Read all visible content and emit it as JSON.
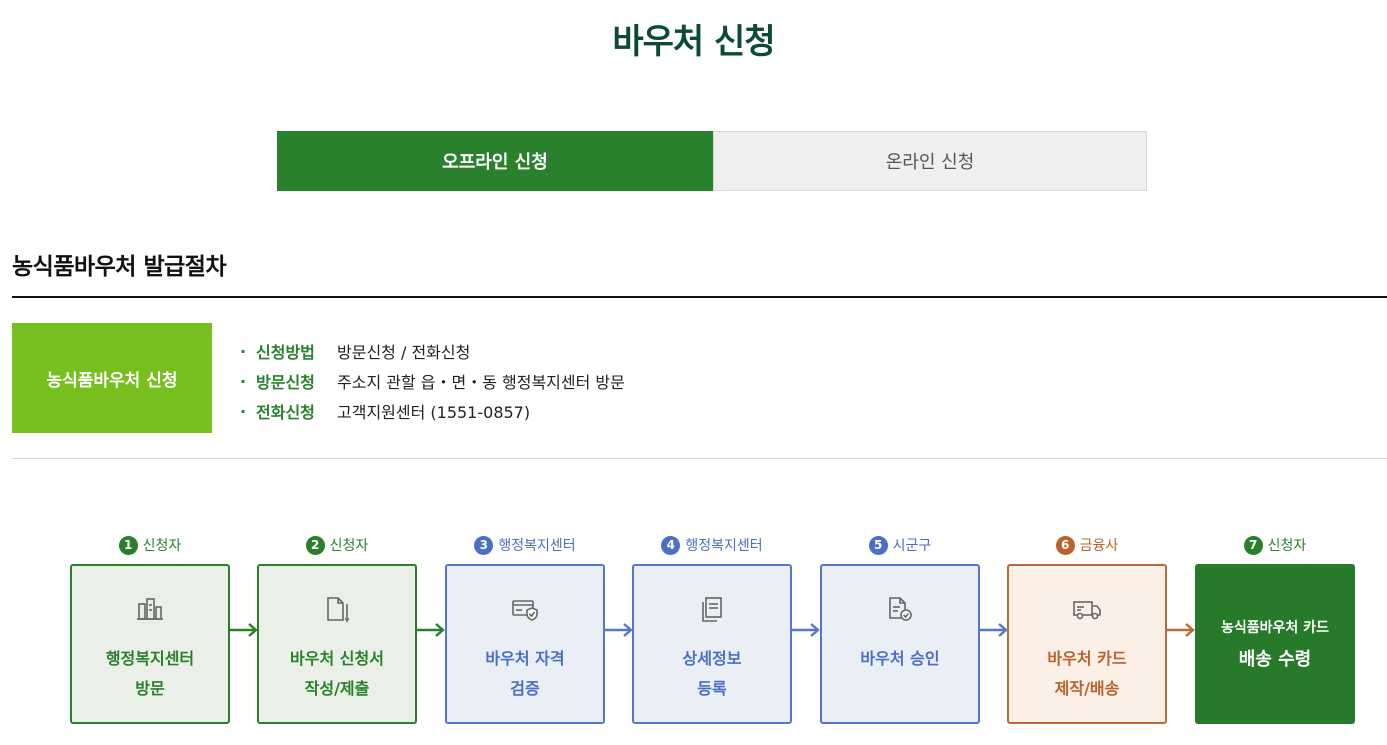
{
  "page": {
    "title": "바우처 신청"
  },
  "tabs": [
    {
      "label": "오프라인 신청",
      "active": true
    },
    {
      "label": "온라인 신청",
      "active": false
    }
  ],
  "section": {
    "title": "농식품바우처 발급절차",
    "apply_box": "농식품바우처 신청",
    "info": [
      {
        "bullet": "·",
        "key": "신청방법",
        "value": "방문신청 / 전화신청"
      },
      {
        "bullet": "·",
        "key": "방문신청",
        "value": "주소지 관할 읍・면・동 행정복지센터 방문"
      },
      {
        "bullet": "·",
        "key": "전화신청",
        "value": "고객지원센터 (1551-0857)"
      }
    ]
  },
  "steps": [
    {
      "num": "1",
      "actor": "신청자",
      "line1": "행정복지센터",
      "line2": "방문",
      "icon": "building-icon",
      "theme": "green"
    },
    {
      "num": "2",
      "actor": "신청자",
      "line1": "바우처 신청서",
      "line2": "작성/제출",
      "icon": "document-pen-icon",
      "theme": "green"
    },
    {
      "num": "3",
      "actor": "행정복지센터",
      "line1": "바우처 자격",
      "line2": "검증",
      "icon": "card-shield-icon",
      "theme": "blue"
    },
    {
      "num": "4",
      "actor": "행정복지센터",
      "line1": "상세정보",
      "line2": "등록",
      "icon": "copy-documents-icon",
      "theme": "blue"
    },
    {
      "num": "5",
      "actor": "시군구",
      "line1": "바우처 승인",
      "line2": "",
      "icon": "document-check-icon",
      "theme": "blue"
    },
    {
      "num": "6",
      "actor": "금융사",
      "line1": "바우처 카드",
      "line2": "제작/배송",
      "icon": "delivery-truck-icon",
      "theme": "orange"
    },
    {
      "num": "7",
      "actor": "신청자",
      "line1": "농식품바우처 카드",
      "line2": "배송 수령",
      "icon": "",
      "theme": "final"
    }
  ],
  "colors": {
    "green": "#29812b",
    "lime": "#76bf1f",
    "blue": "#4a6fc4",
    "orange": "#b7632c",
    "title": "#0b4a33"
  }
}
